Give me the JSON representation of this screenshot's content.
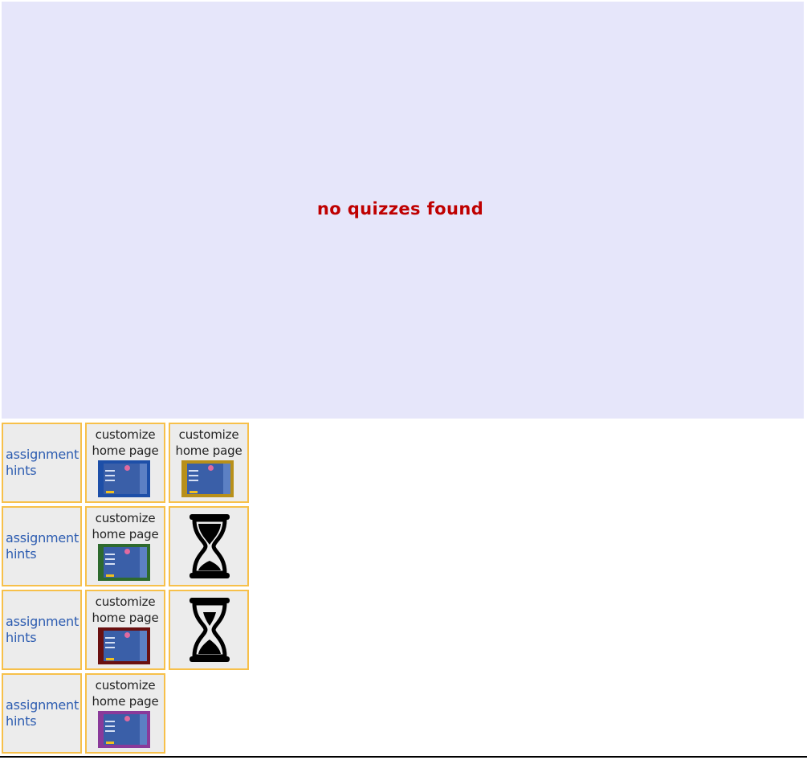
{
  "message": "no quizzes found",
  "colors": {
    "panel_bg": "#e6e6fa",
    "message": "#bf0000",
    "tile_border": "#f7c04a",
    "hint_link": "#2b5bb0"
  },
  "rows": [
    {
      "hint_label": "assignment hints",
      "customize": [
        {
          "label": "customize home page",
          "theme_color": "#1d4fa8"
        },
        {
          "label": "customize home page",
          "theme_color": "#b8901a"
        }
      ]
    },
    {
      "hint_label": "assignment hints",
      "customize": [
        {
          "label": "customize home page",
          "theme_color": "#2e6a2e"
        }
      ],
      "loading_icon": "hourglass-icon"
    },
    {
      "hint_label": "assignment hints",
      "customize": [
        {
          "label": "customize home page",
          "theme_color": "#6a1010"
        }
      ],
      "loading_icon": "hourglass-icon"
    },
    {
      "hint_label": "assignment hints",
      "customize": [
        {
          "label": "customize home page",
          "theme_color": "#8a3a9a"
        }
      ]
    }
  ]
}
